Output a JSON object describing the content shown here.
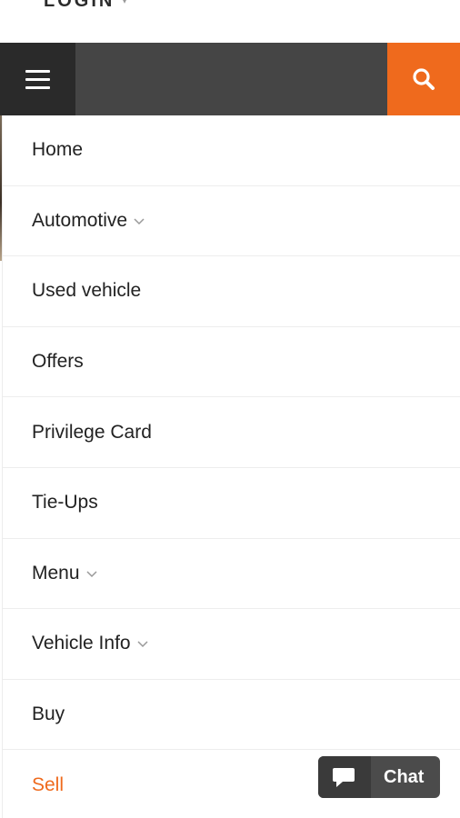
{
  "header": {
    "login_label": "LOGIN",
    "login_caret": "▾"
  },
  "navbar": {
    "menu_icon": "hamburger-icon",
    "search_icon": "search-icon",
    "accent_color": "#ef6a1d",
    "bar_color": "#454545"
  },
  "menu": {
    "items": [
      {
        "label": "Home",
        "has_dropdown": false
      },
      {
        "label": "Automotive",
        "has_dropdown": true
      },
      {
        "label": "Used vehicle",
        "has_dropdown": false
      },
      {
        "label": "Offers",
        "has_dropdown": false
      },
      {
        "label": "Privilege Card",
        "has_dropdown": false
      },
      {
        "label": "Tie-Ups",
        "has_dropdown": false
      },
      {
        "label": "Menu",
        "has_dropdown": true
      },
      {
        "label": "Vehicle Info",
        "has_dropdown": true
      },
      {
        "label": "Buy",
        "has_dropdown": false
      },
      {
        "label": "Sell",
        "has_dropdown": false
      }
    ]
  },
  "chat": {
    "label": "Chat",
    "icon": "chat-bubble-icon"
  }
}
